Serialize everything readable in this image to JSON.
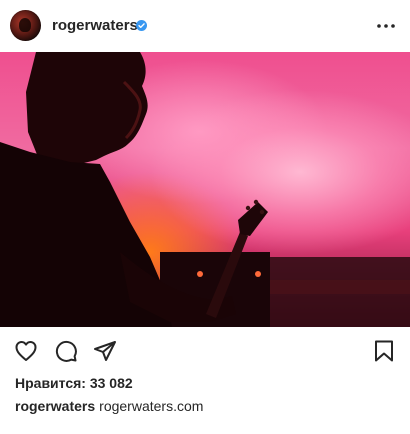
{
  "post": {
    "username": "rogerwaters",
    "verified": true,
    "likes_label": "Нравится: 33 082",
    "caption_user": "rogerwaters",
    "caption_text": "rogerwaters.com"
  },
  "icons": {
    "header": [
      "avatar",
      "verified-badge-icon",
      "more-options-icon"
    ],
    "actions": [
      "heart-icon",
      "comment-icon",
      "share-icon",
      "bookmark-icon"
    ]
  },
  "colors": {
    "text": "#262626",
    "verified": "#3897f0",
    "photo_accent": "#ef4f8f"
  }
}
